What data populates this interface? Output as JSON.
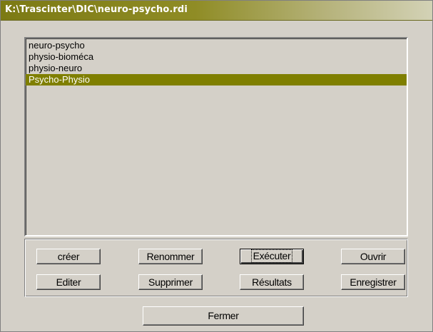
{
  "window": {
    "title": "K:\\Trascinter\\DIC\\neuro-psycho.rdi"
  },
  "list": {
    "items": [
      {
        "label": "neuro-psycho",
        "selected": false
      },
      {
        "label": "physio-bioméca",
        "selected": false
      },
      {
        "label": "physio-neuro",
        "selected": false
      },
      {
        "label": "Psycho-Physio",
        "selected": true
      }
    ],
    "selected_color": "#7f7f00"
  },
  "buttons": {
    "creer": "créer",
    "renommer": "Renommer",
    "executer": "Exécuter",
    "ouvrir": "Ouvrir",
    "editer": "Editer",
    "supprimer": "Supprimer",
    "resultats": "Résultats",
    "enregistrer": "Enregistrer",
    "fermer": "Fermer"
  },
  "colors": {
    "face": "#d4d0c8",
    "title_gradient_start": "#7c7a14",
    "title_gradient_end": "#d3d2b6"
  }
}
